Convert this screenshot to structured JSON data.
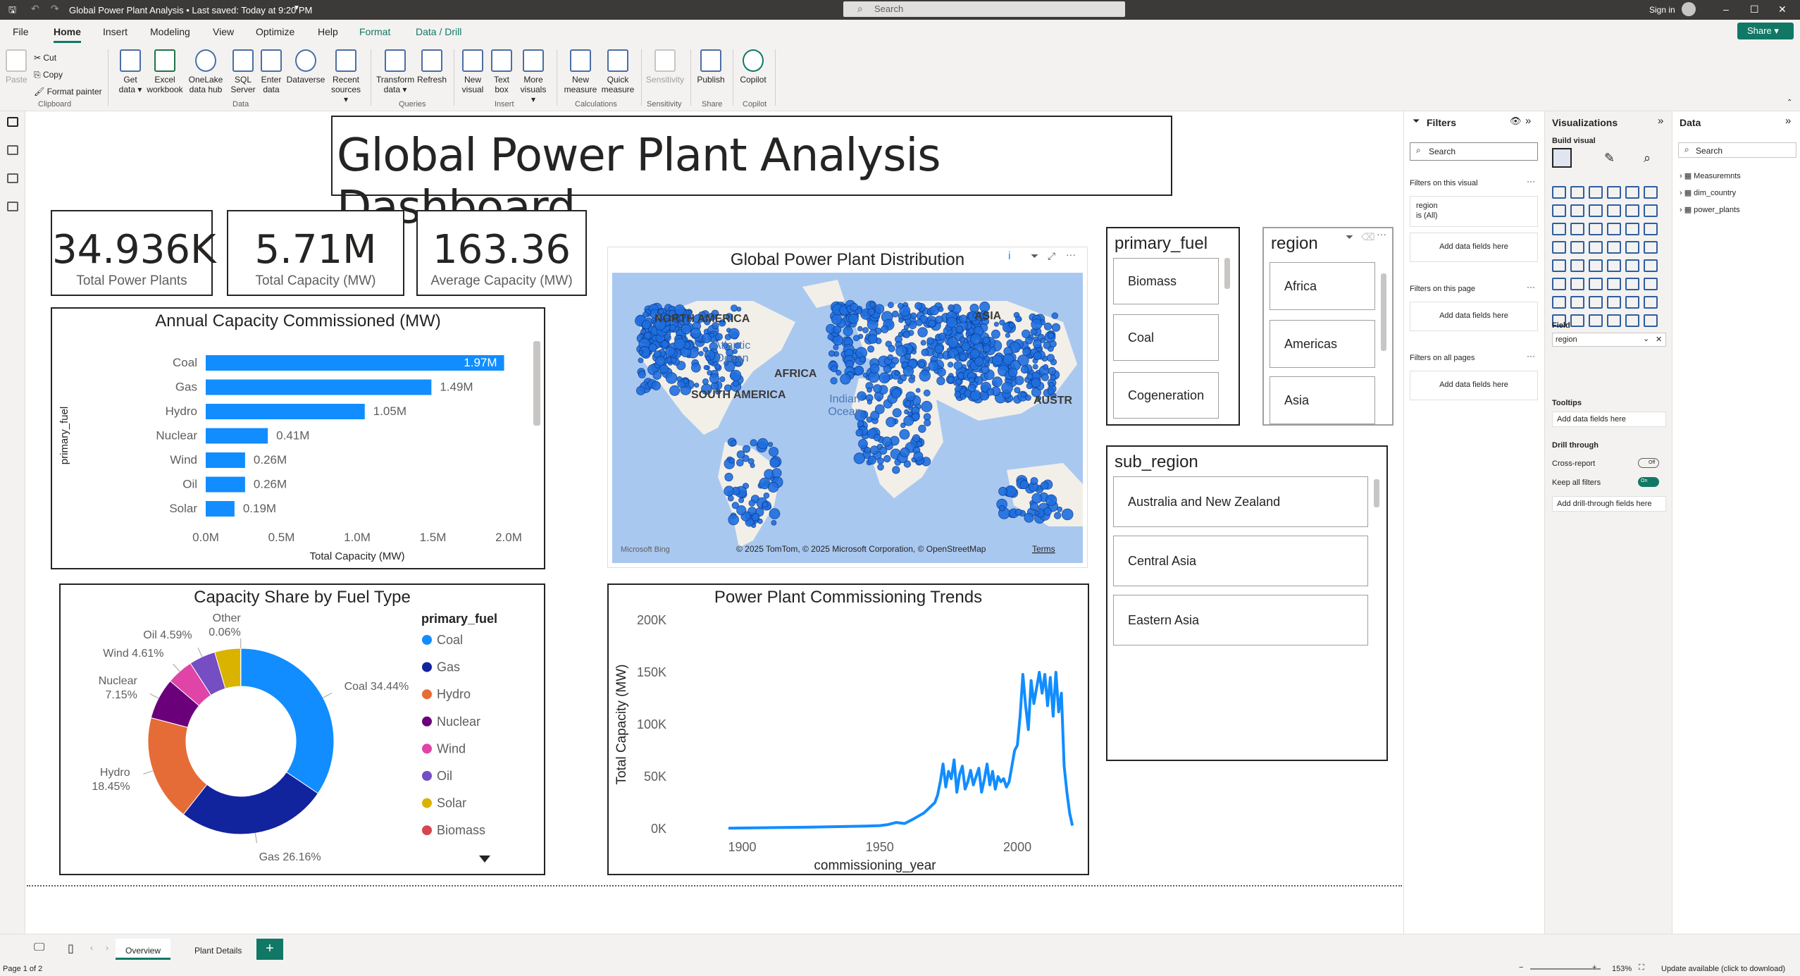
{
  "titlebar": {
    "title": "Global Power Plant Analysis • Last saved: Today at 9:20 PM",
    "search_placeholder": "Search",
    "sign_in": "Sign in",
    "share": "Share"
  },
  "menu": [
    "File",
    "Home",
    "Insert",
    "Modeling",
    "View",
    "Optimize",
    "Help",
    "Format",
    "Data / Drill"
  ],
  "ribbon": {
    "clipboard": {
      "paste": "Paste",
      "cut": "Cut",
      "copy": "Copy",
      "format_painter": "Format painter",
      "group": "Clipboard"
    },
    "data": {
      "get_data": "Get data",
      "excel": "Excel workbook",
      "onelake": "OneLake data hub",
      "sql": "SQL Server",
      "enter": "Enter data",
      "dataverse": "Dataverse",
      "recent": "Recent sources",
      "group": "Data"
    },
    "queries": {
      "transform": "Transform data",
      "refresh": "Refresh",
      "group": "Queries"
    },
    "insert": {
      "new_visual": "New visual",
      "text_box": "Text box",
      "more_visuals": "More visuals",
      "group": "Insert"
    },
    "calculations": {
      "new_measure": "New measure",
      "quick_measure": "Quick measure",
      "group": "Calculations"
    },
    "sensitivity": {
      "label": "Sensitivity",
      "group": "Sensitivity"
    },
    "share": {
      "publish": "Publish",
      "group": "Share"
    },
    "copilot": {
      "label": "Copilot",
      "group": "Copilot"
    }
  },
  "dashboard": {
    "title": "Global Power Plant Analysis Dashboard",
    "kpis": [
      {
        "value": "34.936K",
        "label": "Total Power Plants"
      },
      {
        "value": "5.71M",
        "label": "Total Capacity (MW)"
      },
      {
        "value": "163.36",
        "label": "Average Capacity (MW)"
      }
    ],
    "map": {
      "title": "Global Power Plant Distribution",
      "labels": [
        "NORTH AMERICA",
        "ASIA",
        "AFRICA",
        "SOUTH AMERICA",
        "AUSTR",
        "Atlantic Ocean",
        "Indian Ocean"
      ],
      "attribution": "© 2025 TomTom, © 2025 Microsoft Corporation, © OpenStreetMap",
      "terms": "Terms",
      "bing": "Microsoft Bing"
    },
    "slicers": {
      "primary_fuel": {
        "title": "primary_fuel",
        "items": [
          "Biomass",
          "Coal",
          "Cogeneration"
        ]
      },
      "region": {
        "title": "region",
        "items": [
          "Africa",
          "Americas",
          "Asia"
        ]
      },
      "sub_region": {
        "title": "sub_region",
        "items": [
          "Australia and New Zealand",
          "Central Asia",
          "Eastern Asia"
        ]
      }
    }
  },
  "chart_data": [
    {
      "type": "bar",
      "title": "Annual Capacity Commissioned (MW)",
      "xlabel": "Total Capacity (MW)",
      "ylabel": "primary_fuel",
      "categories": [
        "Coal",
        "Gas",
        "Hydro",
        "Nuclear",
        "Wind",
        "Oil",
        "Solar"
      ],
      "values": [
        1.97,
        1.49,
        1.05,
        0.41,
        0.26,
        0.26,
        0.19
      ],
      "value_labels": [
        "1.97M",
        "1.49M",
        "1.05M",
        "0.41M",
        "0.26M",
        "0.26M",
        "0.19M"
      ],
      "xticks": [
        "0.0M",
        "0.5M",
        "1.0M",
        "1.5M",
        "2.0M"
      ],
      "xlim": [
        0,
        2.0
      ],
      "color": "#118dff"
    },
    {
      "type": "pie",
      "title": "Capacity Share by Fuel Type",
      "legend_title": "primary_fuel",
      "legend": [
        "Coal",
        "Gas",
        "Hydro",
        "Nuclear",
        "Wind",
        "Oil",
        "Solar",
        "Biomass"
      ],
      "slices": [
        {
          "name": "Coal",
          "value": 34.44,
          "label": "Coal 34.44%",
          "color": "#118dff"
        },
        {
          "name": "Gas",
          "value": 26.16,
          "label": "Gas 26.16%",
          "color": "#12239e"
        },
        {
          "name": "Hydro",
          "value": 18.45,
          "label": "Hydro 18.45%",
          "color": "#e66c37"
        },
        {
          "name": "Nuclear",
          "value": 7.15,
          "label": "Nuclear 7.15%",
          "color": "#6b007b"
        },
        {
          "name": "Wind",
          "value": 4.61,
          "label": "Wind 4.61%",
          "color": "#e044a7"
        },
        {
          "name": "Oil",
          "value": 4.59,
          "label": "Oil 4.59%",
          "color": "#744ec2"
        },
        {
          "name": "Solar",
          "value": 4.5,
          "label": "",
          "color": "#d9b300"
        },
        {
          "name": "Other",
          "value": 0.06,
          "label": "Other 0.06%",
          "color": "#d64550"
        }
      ],
      "legend_colors": [
        "#118dff",
        "#12239e",
        "#e66c37",
        "#6b007b",
        "#e044a7",
        "#744ec2",
        "#d9b300",
        "#d64550"
      ]
    },
    {
      "type": "line",
      "title": "Power Plant Commissioning Trends",
      "xlabel": "commissioning_year",
      "ylabel": "Total Capacity (MW)",
      "xticks": [
        "1900",
        "1950",
        "2000"
      ],
      "yticks": [
        "0K",
        "50K",
        "100K",
        "150K",
        "200K"
      ],
      "xlim": [
        1895,
        2022
      ],
      "ylim": [
        0,
        200000
      ],
      "x": [
        1895,
        1905,
        1915,
        1925,
        1935,
        1945,
        1950,
        1953,
        1956,
        1959,
        1962,
        1964,
        1966,
        1968,
        1970,
        1971,
        1972,
        1973,
        1974,
        1975,
        1976,
        1977,
        1978,
        1979,
        1980,
        1981,
        1982,
        1983,
        1984,
        1985,
        1986,
        1987,
        1988,
        1989,
        1990,
        1991,
        1992,
        1993,
        1994,
        1995,
        1996,
        1997,
        1998,
        1999,
        2000,
        2001,
        2002,
        2003,
        2004,
        2005,
        2006,
        2007,
        2008,
        2009,
        2010,
        2011,
        2012,
        2013,
        2014,
        2015,
        2016,
        2017,
        2018,
        2019,
        2020
      ],
      "y": [
        500,
        800,
        1200,
        1500,
        2000,
        2500,
        3000,
        4000,
        6000,
        5000,
        9000,
        12000,
        15000,
        20000,
        25000,
        32000,
        45000,
        62000,
        40000,
        55000,
        48000,
        66000,
        35000,
        52000,
        60000,
        38000,
        45000,
        56000,
        42000,
        50000,
        58000,
        35000,
        47000,
        62000,
        42000,
        55000,
        38000,
        50000,
        45000,
        48000,
        40000,
        45000,
        60000,
        75000,
        80000,
        108000,
        148000,
        118000,
        95000,
        142000,
        120000,
        135000,
        150000,
        130000,
        148000,
        118000,
        145000,
        108000,
        150000,
        112000,
        130000,
        60000,
        35000,
        15000,
        3000
      ],
      "color": "#118dff"
    }
  ],
  "filters": {
    "title": "Filters",
    "search": "Search",
    "on_visual": "Filters on this visual",
    "region_card": "region",
    "region_value": "is (All)",
    "add_fields": "Add data fields here",
    "on_page": "Filters on this page",
    "on_all": "Filters on all pages"
  },
  "visualizations": {
    "title": "Visualizations",
    "build": "Build visual",
    "field_label": "Field",
    "field_value": "region",
    "tooltips": "Tooltips",
    "tooltips_add": "Add data fields here",
    "drill": "Drill through",
    "cross_report": "Cross-report",
    "cross_state": "Off",
    "keep_filters": "Keep all filters",
    "keep_state": "On",
    "drill_add": "Add drill-through fields here"
  },
  "data_pane": {
    "title": "Data",
    "search": "Search",
    "tables": [
      "Measuremnts",
      "dim_country",
      "power_plants"
    ]
  },
  "pages": {
    "tabs": [
      "Overview",
      "Plant Details"
    ],
    "add": "+"
  },
  "status": {
    "page": "Page 1 of 2",
    "zoom": "153%",
    "update": "Update available (click to download)"
  }
}
